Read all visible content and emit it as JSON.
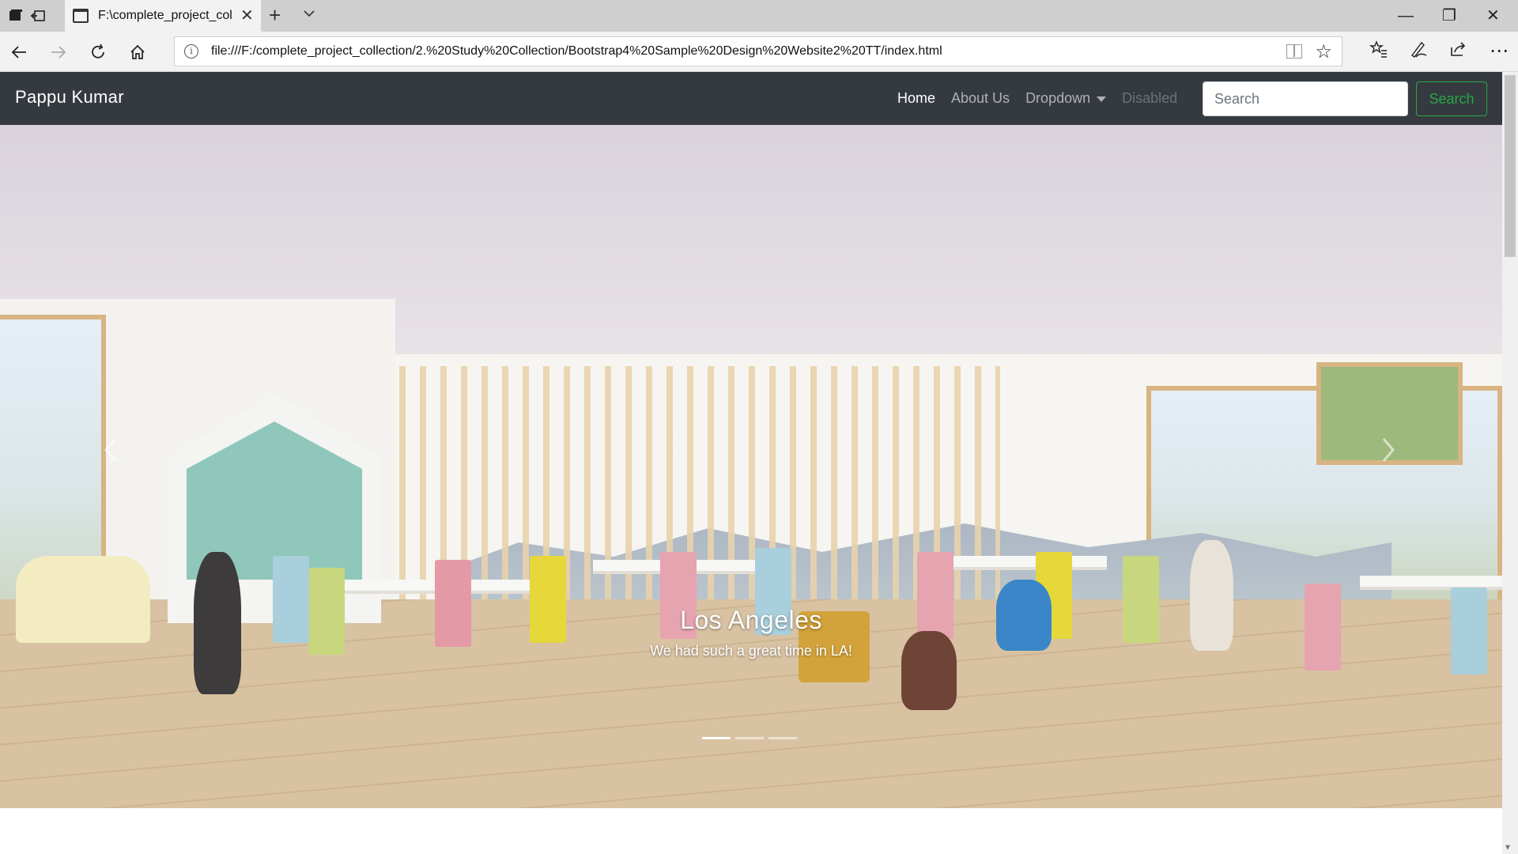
{
  "browser": {
    "tab_title": "F:\\complete_project_col",
    "new_tab_glyph": "+",
    "url": "file:///F:/complete_project_collection/2.%20Study%20Collection/Bootstrap4%20Sample%20Design%20Website2%20TT/index.html",
    "window_controls": {
      "minimize": "—",
      "restore": "❐",
      "close": "✕"
    }
  },
  "navbar": {
    "brand": "Pappu Kumar",
    "links": [
      {
        "label": "Home",
        "state": "active"
      },
      {
        "label": "About Us",
        "state": "normal"
      },
      {
        "label": "Dropdown",
        "state": "normal"
      },
      {
        "label": "Disabled",
        "state": "disabled"
      }
    ],
    "search_placeholder": "Search",
    "search_button": "Search",
    "colors": {
      "background": "#343a40",
      "search_button": "#28a745"
    }
  },
  "carousel": {
    "caption_title": "Los Angeles",
    "caption_text": "We had such a great time in LA!",
    "slide_count": 3,
    "active_slide": 1,
    "prev_icon": "chevron-left-icon",
    "next_icon": "chevron-right-icon"
  }
}
